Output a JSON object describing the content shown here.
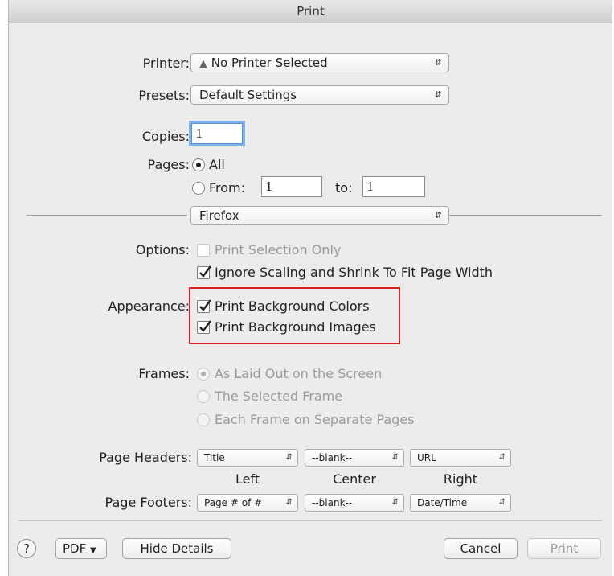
{
  "window": {
    "title": "Print"
  },
  "printer": {
    "label": "Printer:",
    "value": "No Printer Selected",
    "warning_icon": "warning-triangle-icon"
  },
  "presets": {
    "label": "Presets:",
    "value": "Default Settings"
  },
  "copies": {
    "label": "Copies:",
    "value": "1"
  },
  "pages": {
    "label": "Pages:",
    "all_label": "All",
    "from_label": "From:",
    "from_value": "1",
    "to_label": "to:",
    "to_value": "1",
    "selected": "All"
  },
  "section_popup": {
    "value": "Firefox"
  },
  "options": {
    "label": "Options:",
    "print_selection_only": "Print Selection Only",
    "ignore_scaling": "Ignore Scaling and Shrink To Fit Page Width"
  },
  "appearance": {
    "label": "Appearance:",
    "print_bg_colors": "Print Background Colors",
    "print_bg_images": "Print Background Images",
    "highlight_color": "#d1232a"
  },
  "frames": {
    "label": "Frames:",
    "as_laid_out": "As Laid Out on the Screen",
    "selected_frame": "The Selected Frame",
    "each_frame": "Each Frame on Separate Pages"
  },
  "headers": {
    "label": "Page Headers:",
    "left": "Title",
    "center": "--blank--",
    "right": "URL"
  },
  "columns": {
    "left": "Left",
    "center": "Center",
    "right": "Right"
  },
  "footers": {
    "label": "Page Footers:",
    "left": "Page # of #",
    "center": "--blank--",
    "right": "Date/Time"
  },
  "bottom": {
    "help": "?",
    "pdf": "PDF",
    "hide_details": "Hide Details",
    "cancel": "Cancel",
    "print": "Print"
  }
}
